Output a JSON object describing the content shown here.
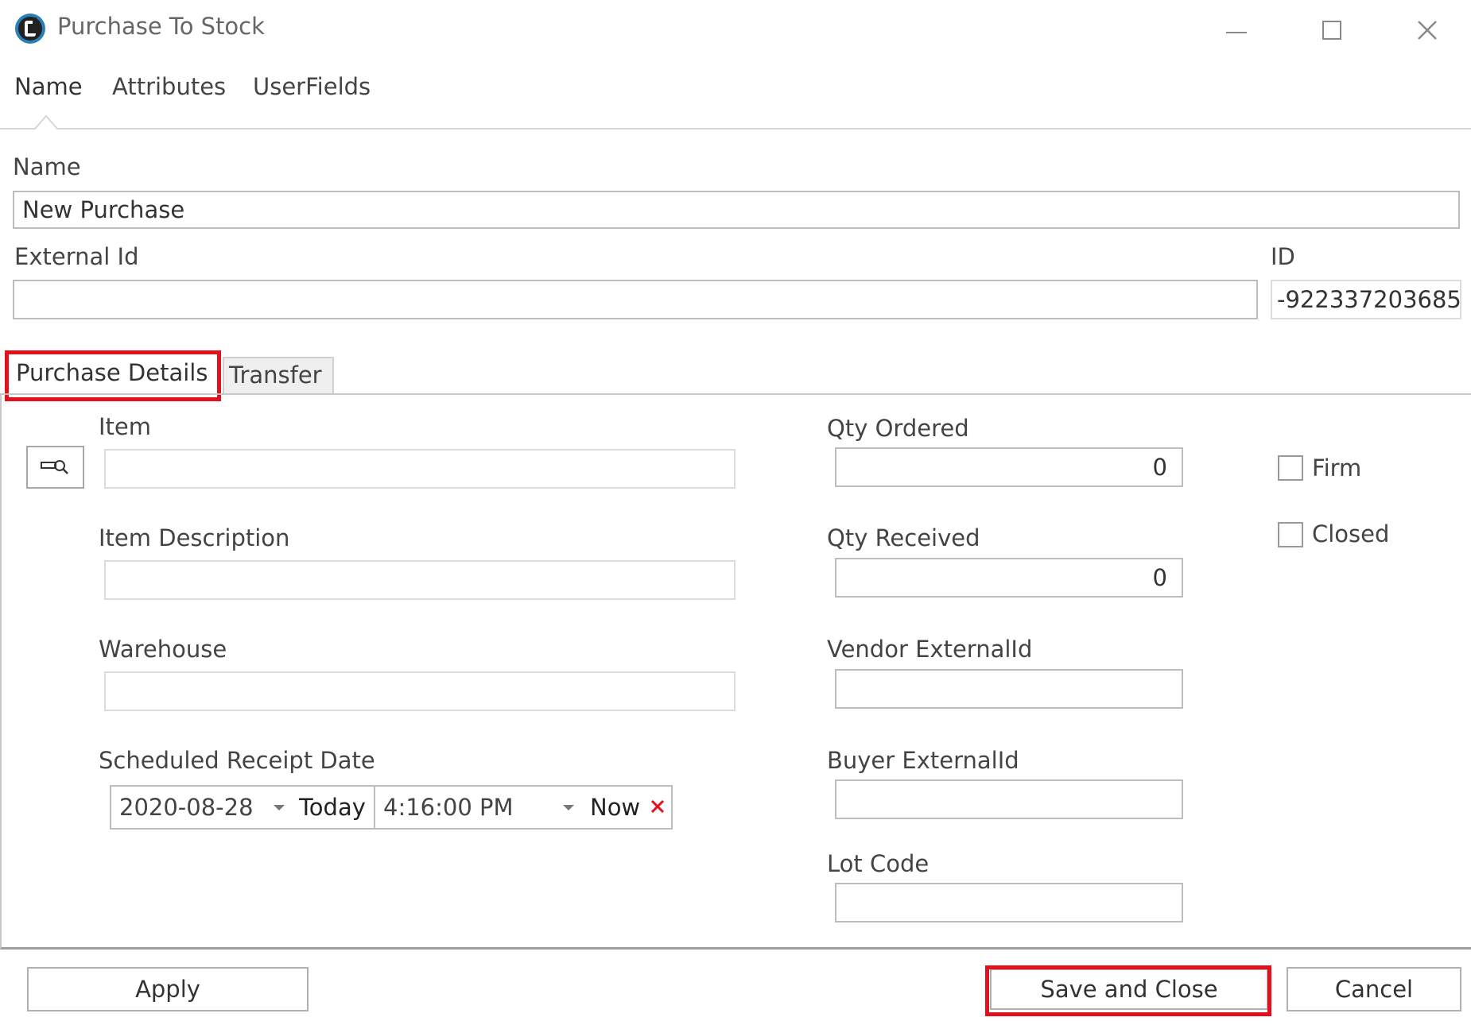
{
  "window": {
    "title": "Purchase To Stock",
    "icon": "app-logo-icon",
    "controls": [
      "minimize-icon",
      "maximize-icon",
      "close-icon"
    ]
  },
  "top_tabs": [
    {
      "label": "Name",
      "selected": true
    },
    {
      "label": "Attributes",
      "selected": false
    },
    {
      "label": "UserFields",
      "selected": false
    }
  ],
  "form": {
    "name_label": "Name",
    "name_value": "New Purchase",
    "external_id_label": "External Id",
    "external_id_value": "",
    "id_label": "ID",
    "id_value": "-922337203685"
  },
  "inner_tabs": [
    {
      "label": "Purchase Details",
      "selected": true,
      "highlighted": true
    },
    {
      "label": "Transfer",
      "selected": false
    }
  ],
  "details": {
    "item_label": "Item",
    "item_value": "",
    "item_lookup_icon": "search-lookup-icon",
    "item_description_label": "Item Description",
    "item_description_value": "",
    "warehouse_label": "Warehouse",
    "warehouse_value": "",
    "scheduled_receipt_label": "Scheduled Receipt Date",
    "date_value": "2020-08-28",
    "today_label": "Today",
    "time_value": "4:16:00 PM",
    "now_label": "Now",
    "clear_icon": "close-x-icon",
    "qty_ordered_label": "Qty Ordered",
    "qty_ordered_value": "0",
    "qty_received_label": "Qty Received",
    "qty_received_value": "0",
    "vendor_external_id_label": "Vendor ExternalId",
    "vendor_external_id_value": "",
    "buyer_external_id_label": "Buyer ExternalId",
    "buyer_external_id_value": "",
    "lot_code_label": "Lot Code",
    "lot_code_value": "",
    "firm_label": "Firm",
    "firm_checked": false,
    "closed_label": "Closed",
    "closed_checked": false
  },
  "footer": {
    "apply_label": "Apply",
    "save_close_label": "Save and Close",
    "save_close_highlighted": true,
    "cancel_label": "Cancel"
  },
  "colors": {
    "highlight": "#e3101e",
    "clear_x": "#e3101e",
    "border": "#bdbdbd"
  }
}
